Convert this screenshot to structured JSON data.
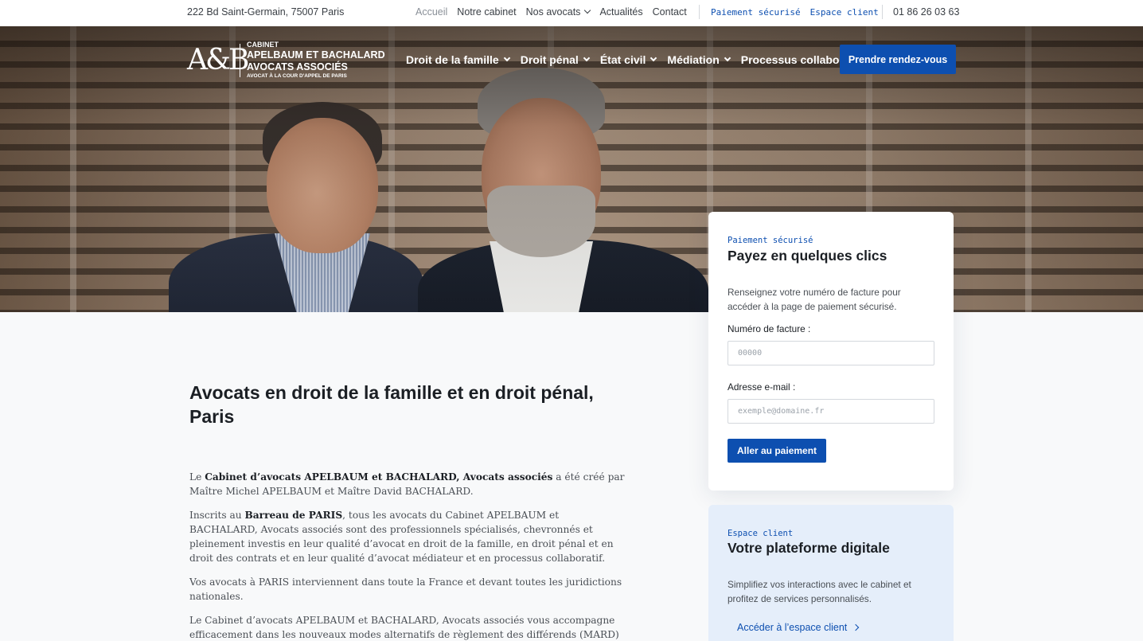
{
  "topbar": {
    "address": "222 Bd Saint-Germain, 75007 Paris",
    "links": [
      "Accueil",
      "Notre cabinet",
      "Nos avocats",
      "Actualités",
      "Contact"
    ],
    "secure_links": [
      "Paiement sécurisé",
      "Espace client"
    ],
    "phone": "01 86 26 03 63"
  },
  "logo": {
    "mark": "A&B",
    "line1": "CABINET",
    "line2": "APELBAUM ET BACHALARD",
    "line3": "AVOCATS ASSOCIÉS",
    "line4": "AVOCAT À LA COUR D'APPEL DE PARIS"
  },
  "nav": {
    "items": [
      "Droit de la famille",
      "Droit pénal",
      "État civil",
      "Médiation",
      "Processus collaboratif"
    ],
    "cta": "Prendre rendez-vous"
  },
  "main": {
    "title": "Avocats en droit de la famille et en droit pénal, Paris",
    "p1_pre": "Le ",
    "p1_strong": "Cabinet d’avocats APELBAUM et BACHALARD, Avocats associés",
    "p1_post": " a été créé par Maître Michel APELBAUM et Maître David BACHALARD.",
    "p2_pre": "Inscrits au ",
    "p2_strong": "Barreau de PARIS",
    "p2_post": ", tous les avocats du Cabinet APELBAUM et BACHALARD, Avocats associés sont des professionnels spécialisés, chevronnés et pleinement investis en leur qualité d’avocat en droit de la famille, en droit pénal et en droit des contrats et en leur qualité d’avocat médiateur et en processus collaboratif.",
    "p3": "Vos avocats à PARIS interviennent dans toute la France et devant toutes les juridictions nationales.",
    "p4": "Le Cabinet d’avocats APELBAUM et BACHALARD, Avocats associés vous accompagne efficacement dans les nouveaux modes alternatifs de règlement des différends (MARD) mis en place par le Barreau de PARIS."
  },
  "payment": {
    "kicker": "Paiement sécurisé",
    "title": "Payez en quelques clics",
    "desc": "Renseignez votre numéro de facture pour accéder à la page de paiement sécurisé.",
    "invoice_label": "Numéro de facture :",
    "invoice_placeholder": "00000",
    "email_label": "Adresse e-mail :",
    "email_placeholder": "exemple@domaine.fr",
    "button": "Aller au paiement"
  },
  "client": {
    "kicker": "Espace client",
    "title": "Votre plateforme digitale",
    "desc": "Simplifiez vos interactions avec le cabinet et profitez de services personnalisés.",
    "link": "Accéder à l’espace client"
  },
  "colors": {
    "accent": "#0d4fb0",
    "client_card_bg": "#e5eefa"
  }
}
